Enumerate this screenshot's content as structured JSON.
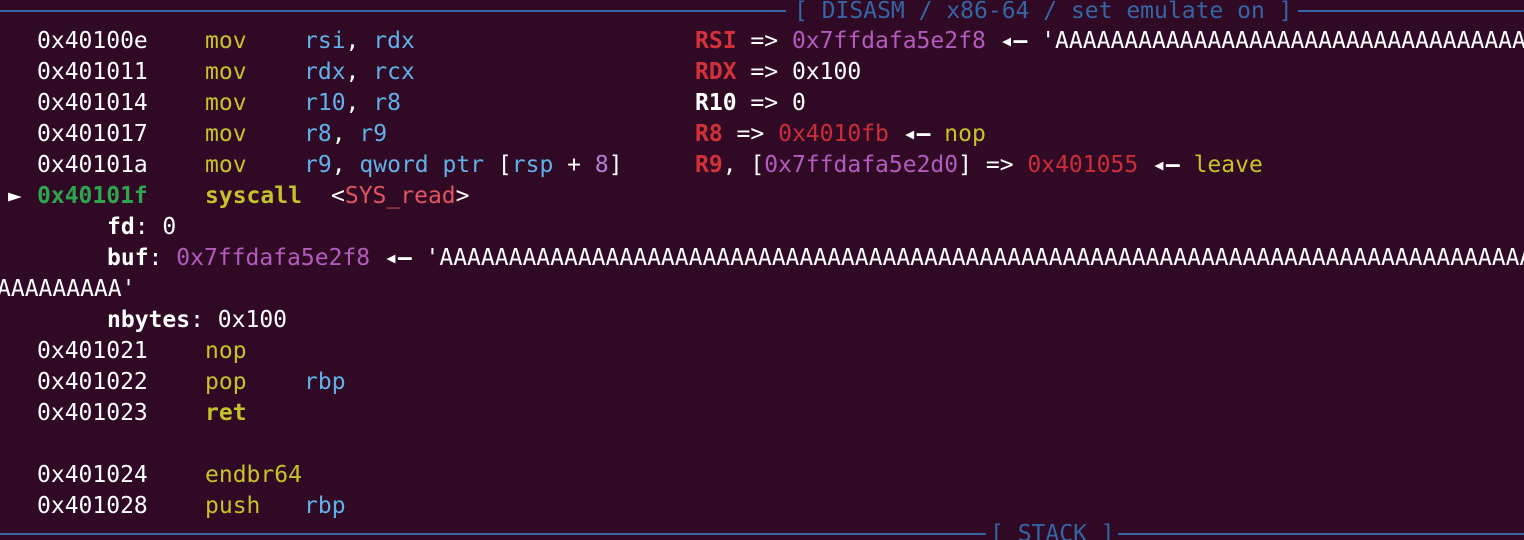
{
  "header": {
    "title": "[ DISASM / x86-64 / set emulate on ]",
    "footer_title": "[ STACK ]"
  },
  "colors": {
    "background": "#300a24",
    "rule": "#3465a4",
    "mnemonic": "#c4c429",
    "register_operand": "#62b0e8",
    "immediate": "#ad7fd8",
    "register_name": "#d3313a",
    "stack_pointer": "#b35bbf",
    "code_pointer": "#cc2d3a",
    "current_address": "#2ea44f"
  },
  "instructions": [
    {
      "addr": "0x40100e",
      "mnem": "mov",
      "op1": "rsi",
      "sep": ", ",
      "op2": "rdx"
    },
    {
      "addr": "0x401011",
      "mnem": "mov",
      "op1": "rdx",
      "sep": ", ",
      "op2": "rcx"
    },
    {
      "addr": "0x401014",
      "mnem": "mov",
      "op1": "r10",
      "sep": ", ",
      "op2": "r8"
    },
    {
      "addr": "0x401017",
      "mnem": "mov",
      "op1": "r8",
      "sep": ", ",
      "op2": "r9"
    },
    {
      "addr": "0x40101a",
      "mnem": "mov",
      "op1": "r9",
      "sep": ", ",
      "op2_prefix": "qword ptr ",
      "op2_open": "[",
      "op2_reg": "rsp",
      "op2_plus": " + ",
      "op2_num": "8",
      "op2_close": "]"
    }
  ],
  "annotations": [
    {
      "reg": "RSI",
      "arrow": " => ",
      "val": "0x7ffdafa5e2f8",
      "larrow": " ◂— ",
      "tail": "'AAAAAAAAAAAAAAAAAAAAAAAAAAAAAAAAAAAAAAAAAAAAAAAAAAAAAAAAAAAAA"
    },
    {
      "reg": "RDX",
      "arrow": " => ",
      "val": "0x100"
    },
    {
      "reg": "R10",
      "arrow": " => ",
      "val": "0"
    },
    {
      "reg": "R8",
      "arrow": " => ",
      "val": "0x4010fb",
      "larrow": " ◂— ",
      "tail": "nop"
    },
    {
      "reg": "R9",
      "comma": ", ",
      "open": "[",
      "val_inner": "0x7ffdafa5e2d0",
      "close": "]",
      "arrow": " => ",
      "val": "0x401055",
      "larrow": " ◂— ",
      "tail": "leave"
    }
  ],
  "current": {
    "marker": "►",
    "addr": "0x40101f",
    "mnem": "syscall",
    "sys_open": "<",
    "sys_name": "SYS_read",
    "sys_close": ">"
  },
  "syscall_args": {
    "fd_name": "fd",
    "fd_colon": ": ",
    "fd_val": "0",
    "buf_name": "buf",
    "buf_colon": ": ",
    "buf_ptr": "0x7ffdafa5e2f8",
    "buf_larrow": " ◂— ",
    "buf_str": "'AAAAAAAAAAAAAAAAAAAAAAAAAAAAAAAAAAAAAAAAAAAAAAAAAAAAAAAAAAAAAAAAAAAAAAAAAAAAAAAAAAAAAAAAAAAAAAAAA",
    "buf_wrap": "AAAAAAAAA'",
    "nbytes_name": "nbytes",
    "nbytes_colon": ": ",
    "nbytes_val": "0x100"
  },
  "after": [
    {
      "addr": "0x401021",
      "mnem": "nop",
      "op1": "",
      "bold": false
    },
    {
      "addr": "0x401022",
      "mnem": "pop",
      "op1": "rbp",
      "bold": false
    },
    {
      "addr": "0x401023",
      "mnem": "ret",
      "op1": "",
      "bold": true
    },
    {
      "addr": "0x401024",
      "mnem": "endbr64",
      "op1": "",
      "bold": false
    },
    {
      "addr": "0x401028",
      "mnem": "push",
      "op1": "rbp",
      "bold": false
    }
  ]
}
